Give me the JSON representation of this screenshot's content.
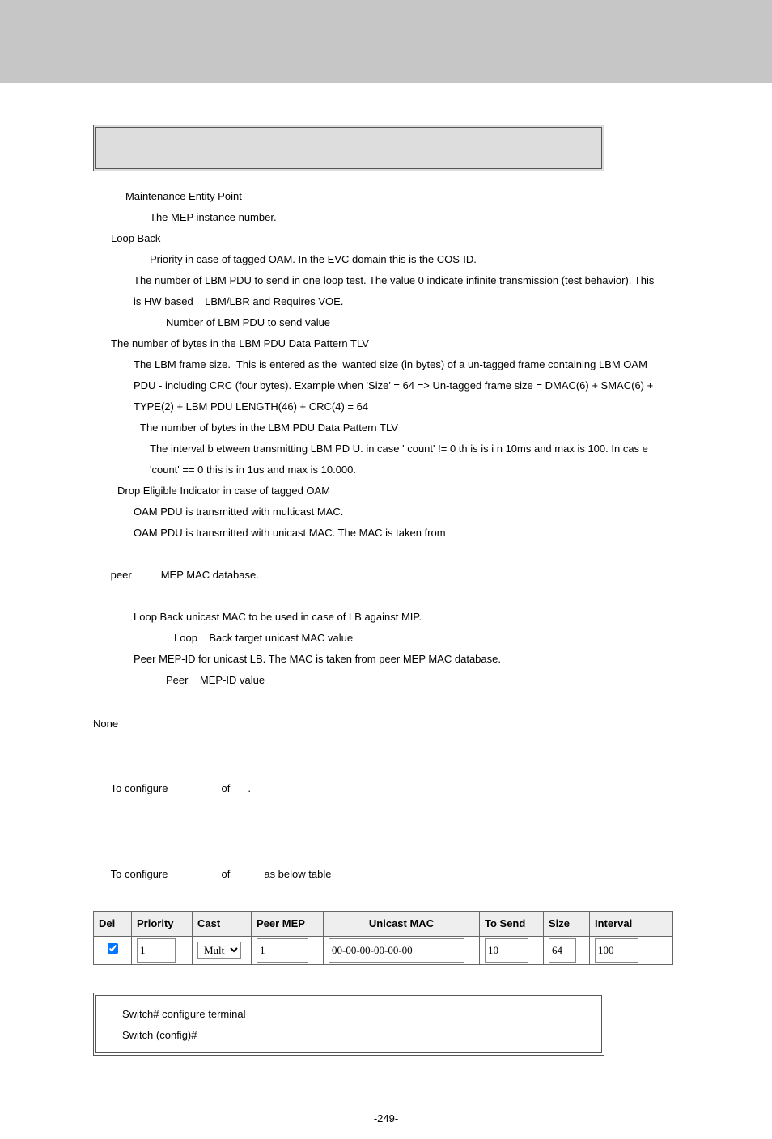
{
  "lines": {
    "l1": "Maintenance Entity Point",
    "l2": "The MEP instance number.",
    "l3": "Loop Back",
    "l4": "Priority in case of tagged OAM. In the EVC domain this is the COS-ID.",
    "l5": "The number of LBM PDU to send in one loop test. The value 0 indicate infinite transmission (test behavior). This",
    "l6": "is HW based    LBM/LBR and Requires VOE.",
    "l7": "Number of LBM PDU to send value",
    "l8": "The number of bytes in the LBM PDU Data Pattern TLV",
    "l9": "The LBM frame size.  This is entered as the  wanted size (in bytes) of a un-tagged frame containing LBM OAM",
    "l10": "PDU - including CRC (four bytes). Example when 'Size' = 64 => Un-tagged frame size = DMAC(6) + SMAC(6) +",
    "l11": "TYPE(2) + LBM PDU LENGTH(46) + CRC(4) = 64",
    "l12": "The number of bytes in the LBM PDU Data Pattern TLV",
    "l13": "The interval b etween transmitting LBM PD U. in case ' count' != 0 th is is i n 10ms and max is 100. In cas e",
    "l14": "'count' == 0 this is in 1us and max is 10.000.",
    "l15": "Drop Eligible Indicator in case of tagged OAM",
    "l16": "OAM PDU is transmitted with multicast MAC.",
    "l17": "OAM PDU is transmitted with unicast MAC. The MAC is taken from",
    "l18_a": "peer",
    "l18_b": "MEP MAC database.",
    "l19": "Loop Back unicast MAC to be used in case of LB against MIP.",
    "l20": "Loop    Back target unicast MAC value",
    "l21": "Peer MEP-ID for unicast LB. The MAC is taken from peer MEP MAC database.",
    "l22": "Peer    MEP-ID value",
    "none": "None",
    "cfg1_a": "To configure",
    "cfg1_b": "of",
    "cfg1_c": ".",
    "cfg2_a": "To configure",
    "cfg2_b": "of",
    "cfg2_c": "as below table",
    "code1": "Switch# configure terminal",
    "code2": "Switch (config)#",
    "pagenum": "-249-"
  },
  "table": {
    "headers": [
      "Dei",
      "Priority",
      "Cast",
      "Peer MEP",
      "Unicast MAC",
      "To Send",
      "Size",
      "Interval"
    ],
    "row": {
      "dei_checked": true,
      "priority": "1",
      "cast": "Multi",
      "peer_mep": "1",
      "unicast_mac": "00-00-00-00-00-00",
      "to_send": "10",
      "size": "64",
      "interval": "100"
    }
  }
}
